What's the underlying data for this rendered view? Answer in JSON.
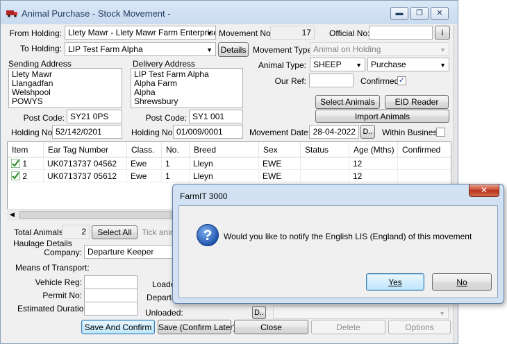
{
  "window": {
    "title": "Animal Purchase - Stock Movement -",
    "controls": {
      "minimize": "▬",
      "maximize": "❐",
      "close": "✕"
    }
  },
  "form": {
    "from_holding_label": "From Holding:",
    "from_holding_value": "Llety Mawr - Llety Mawr Farm Enterprises",
    "to_holding_label": "To Holding:",
    "to_holding_value": "LIP Test Farm Alpha",
    "details_button": "Details",
    "movement_no_label": "Movement No:",
    "movement_no_value": "17",
    "official_no_label": "Official No:",
    "official_no_value": "",
    "official_no_button": "i",
    "movement_type_label": "Movement Type:",
    "movement_type_value": "Animal on Holding",
    "sending_address_label": "Sending Address",
    "sending_address_lines": [
      "Llety Mawr",
      "Llangadfan",
      "Welshpool",
      "POWYS"
    ],
    "delivery_address_label": "Delivery Address",
    "delivery_address_lines": [
      "LIP Test Farm Alpha",
      "Alpha Farm",
      "Alpha",
      "Shrewsbury"
    ],
    "send_postcode_label": "Post Code:",
    "send_postcode_value": "SY21 0PS",
    "deliv_postcode_label": "Post Code:",
    "deliv_postcode_value": "SY1 001",
    "send_holding_label": "Holding No:",
    "send_holding_value": "52/142/0201",
    "deliv_holding_label": "Holding No:",
    "deliv_holding_value": "01/009/0001",
    "animal_type_label": "Animal Type:",
    "animal_type_value": "SHEEP",
    "purchase_value": "Purchase",
    "our_ref_label": "Our Ref:",
    "our_ref_value": "",
    "confirmed_label": "Confirmed:",
    "confirmed_mark": "✓",
    "select_animals_button": "Select Animals",
    "eid_reader_button": "EID Reader",
    "import_animals_button": "Import Animals",
    "movement_date_label": "Movement Date:",
    "movement_date_value": "28-04-2022",
    "date_button": "D..",
    "within_business_label": "Within Business"
  },
  "grid": {
    "columns": [
      "Item",
      "Ear Tag Number",
      "Class.",
      "No.",
      "Breed",
      "Sex",
      "Status",
      "Age (Mths)",
      "Confirmed"
    ],
    "rows": [
      {
        "item": "1",
        "tag": "UK0713737 04562",
        "class": "Ewe",
        "no": "1",
        "breed": "Lleyn",
        "sex": "EWE",
        "status": "",
        "age": "12",
        "confirmed": ""
      },
      {
        "item": "2",
        "tag": "UK0713737 05612",
        "class": "Ewe",
        "no": "1",
        "breed": "Lleyn",
        "sex": "EWE",
        "status": "",
        "age": "12",
        "confirmed": ""
      }
    ]
  },
  "bottom": {
    "total_animals_label": "Total Animals:",
    "total_animals_value": "2",
    "select_all_button": "Select All",
    "tick_hint": "Tick anim",
    "haulage_details_label": "Haulage Details",
    "company_label": "Company:",
    "company_value": "Departure Keeper",
    "means_label": "Means of Transport:",
    "vehicle_label": "Vehicle Reg:",
    "permit_label": "Permit No:",
    "duration_label": "Estimated Duration:",
    "loaded_label": "Loade",
    "departed_label": "Departe",
    "unloaded_label": "Unloaded:",
    "unloaded_date_button": "D.."
  },
  "actions": {
    "save_confirm": "Save And Confirm",
    "save_confirm_later": "Save (Confirm Later)",
    "close": "Close",
    "delete": "Delete",
    "options": "Options"
  },
  "dialog": {
    "title": "FarmIT 3000",
    "close": "✕",
    "icon": "?",
    "message": "Would you like to notify the English LIS (England) of this movement",
    "yes": "Yes",
    "no": "No"
  },
  "colors": {
    "accent_focus": "#3c7fb1",
    "dialog_frame": "#d2e2f2",
    "tick_green": "#2e8b2e"
  },
  "icons": {
    "app": "truck-icon",
    "question": "question-icon",
    "tick": "green-tick-icon",
    "dropdown": "chevron-down-icon"
  }
}
